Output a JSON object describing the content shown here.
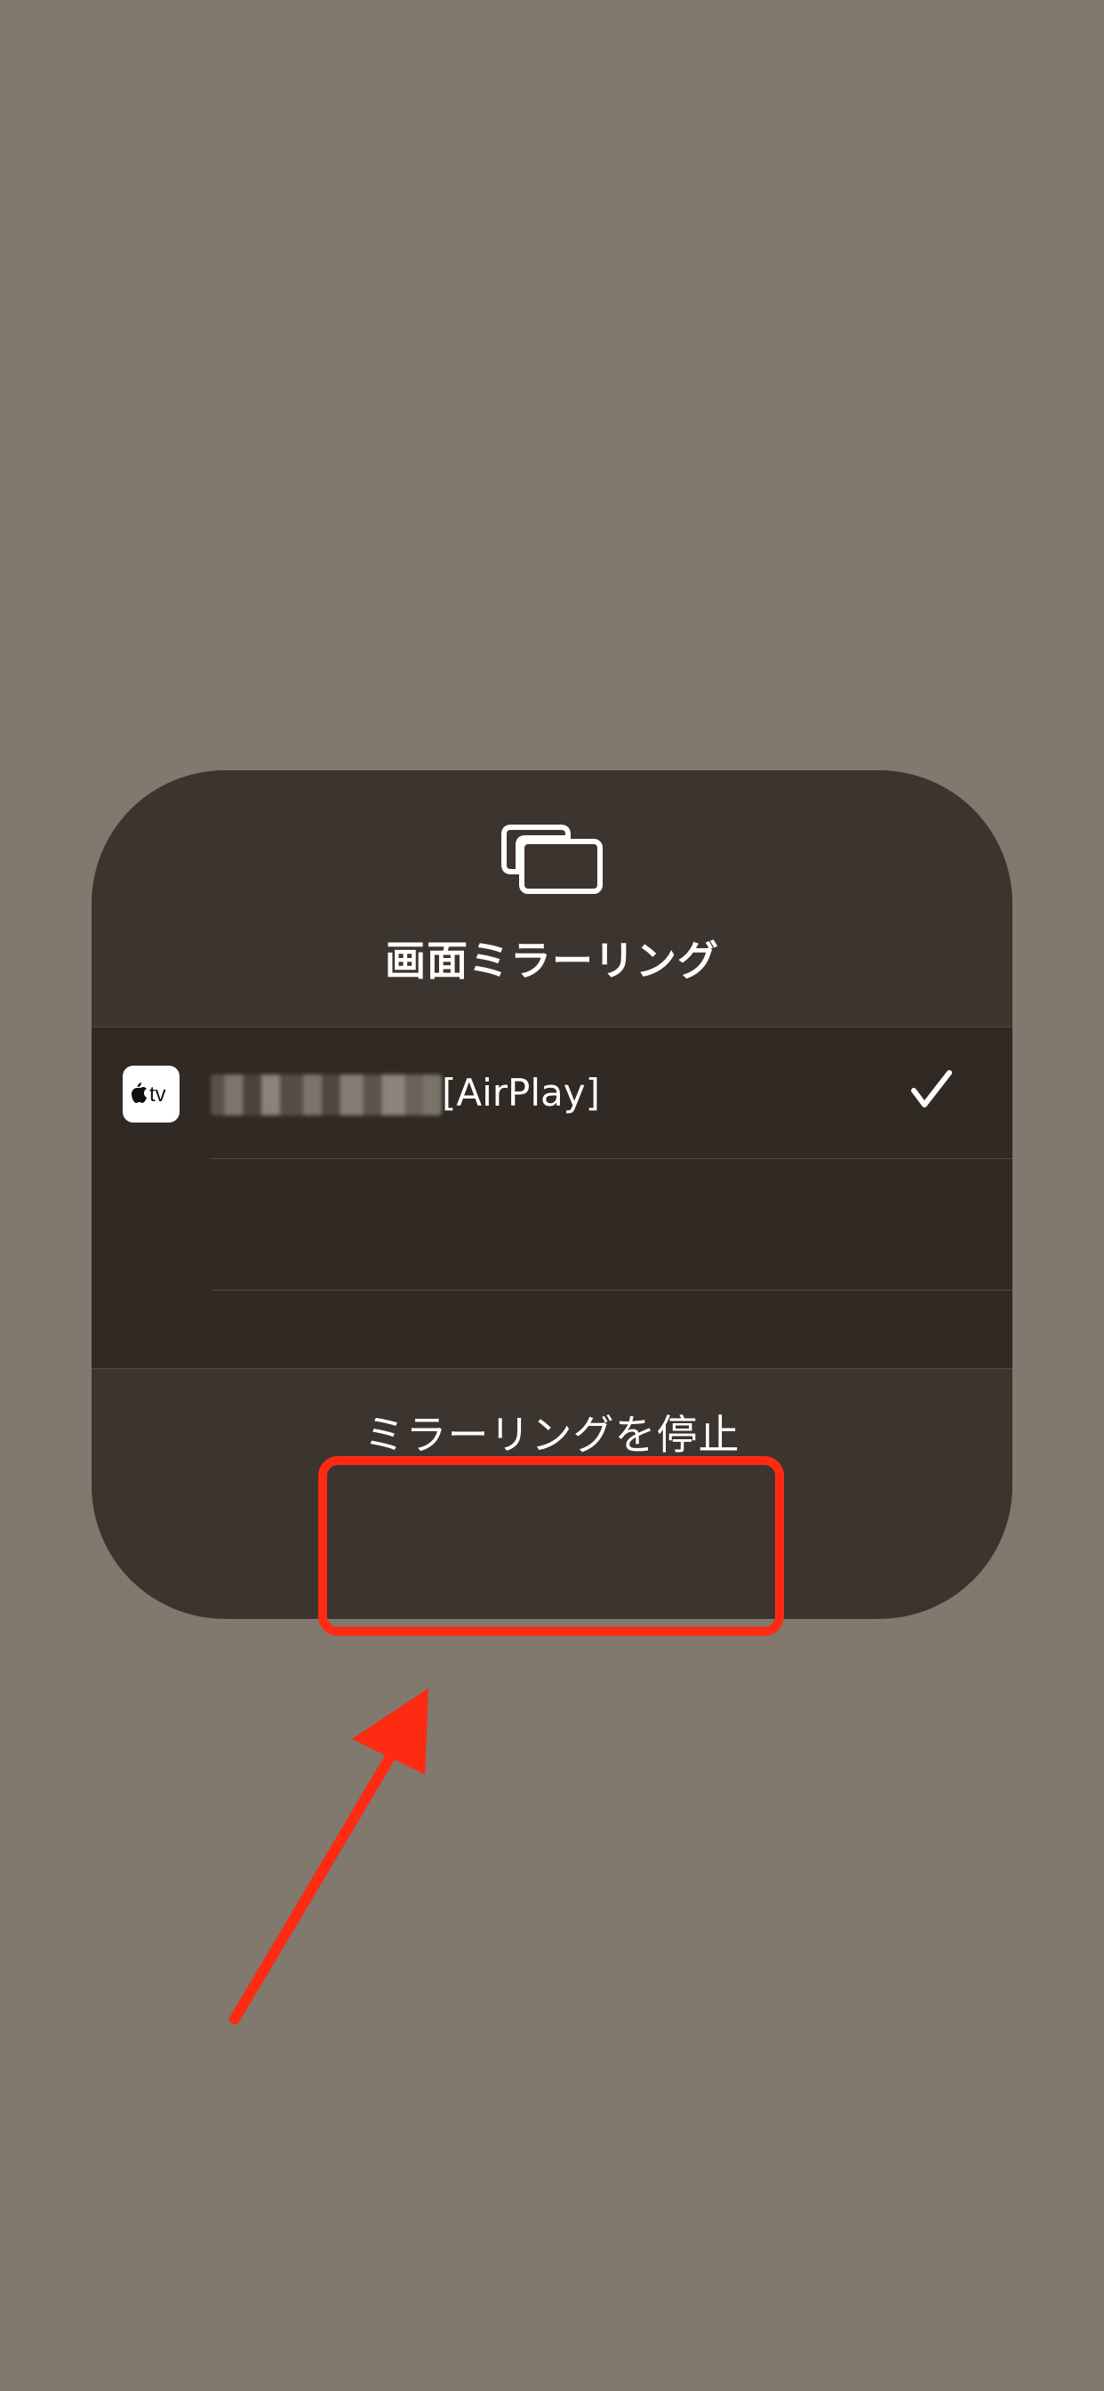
{
  "colors": {
    "background": "#81786e",
    "panel": "#3c342e",
    "list": "#312a24",
    "highlight": "#ff2a12"
  },
  "panel": {
    "icon": "screen-mirroring-icon",
    "title": "画面ミラーリング"
  },
  "devices": [
    {
      "icon": "apple-tv-icon",
      "badge_text": "tv",
      "name_suffix": "[AirPlay]",
      "selected": true
    }
  ],
  "actions": {
    "stop_mirroring": "ミラーリングを停止"
  },
  "annotation": {
    "highlight": "stop-mirroring-button",
    "arrow": "red-arrow-icon"
  }
}
